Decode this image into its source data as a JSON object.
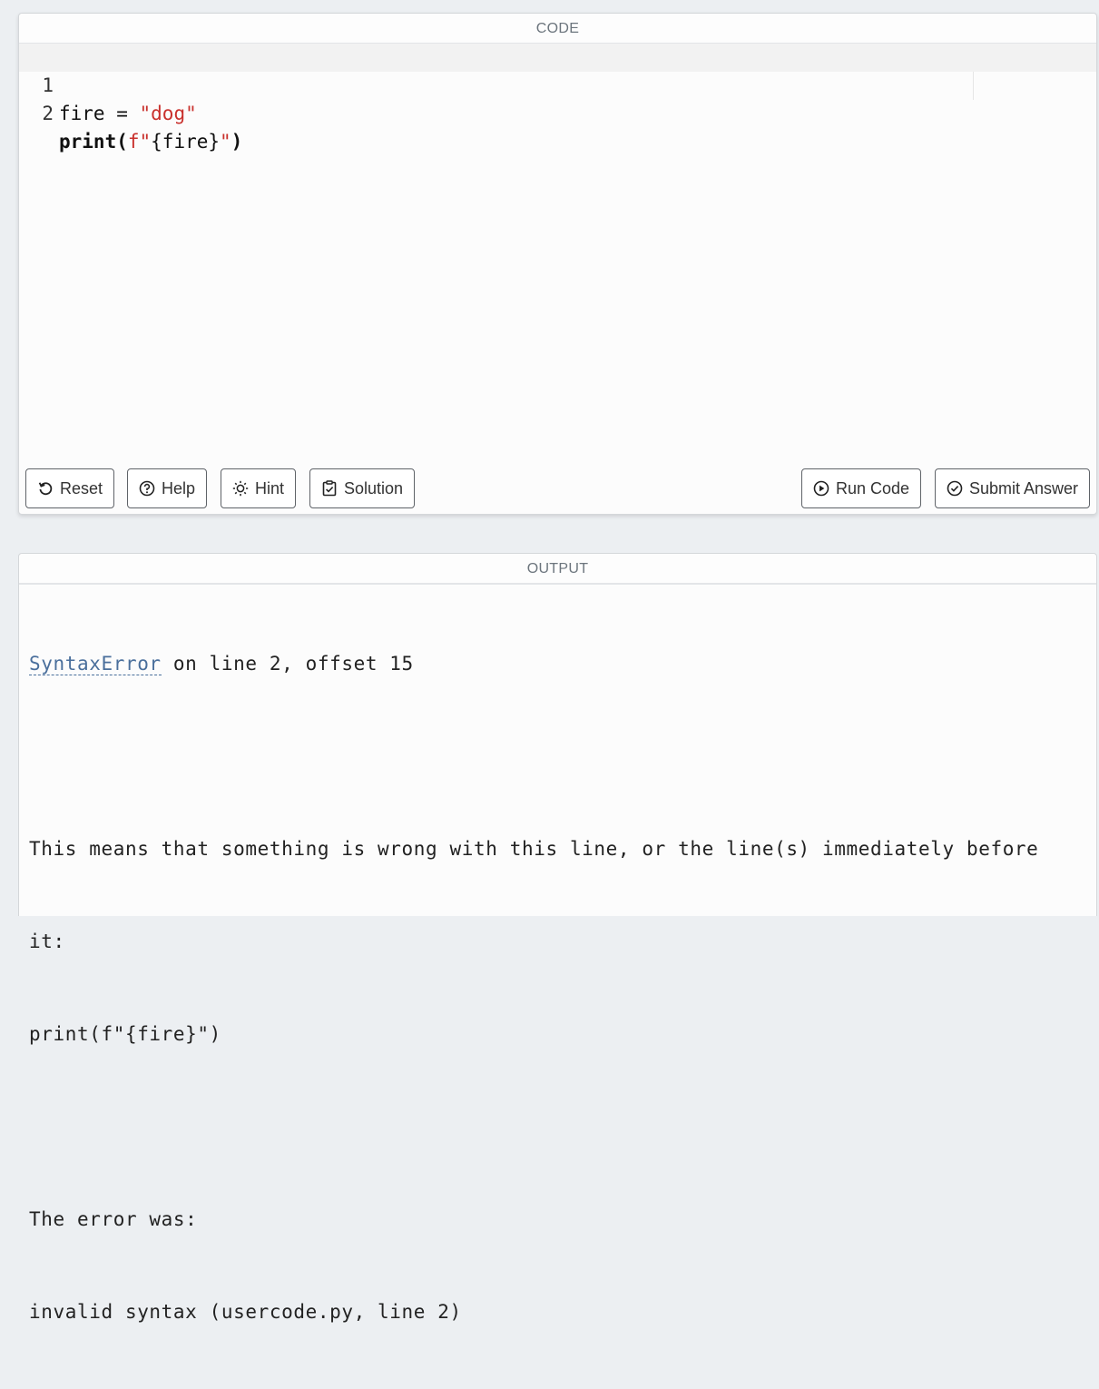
{
  "code_panel": {
    "header": "CODE",
    "lines": [
      {
        "number": "1",
        "tokens": {
          "var": "fire",
          "op": " = ",
          "str": "\"dog\""
        }
      },
      {
        "number": "2",
        "tokens": {
          "kw": "print(",
          "fstr_prefix": "f\"",
          "fstr_body": "{fire}",
          "fstr_end": "\"",
          "close": ")"
        }
      }
    ],
    "buttons": {
      "reset": "Reset",
      "help": "Help",
      "hint": "Hint",
      "solution": "Solution",
      "run": "Run Code",
      "submit": "Submit Answer"
    }
  },
  "output_panel": {
    "header": "OUTPUT",
    "error_name": "SyntaxError",
    "error_location": " on line 2, offset 15",
    "explanation_line1": "This means that something is wrong with this line, or the line(s) immediately before",
    "explanation_line2": "it:",
    "offending_code": "print(f\"{fire}\")",
    "error_was_label": "The error was:",
    "error_message": "invalid syntax (usercode.py, line 2)"
  },
  "colors": {
    "background": "#eceff2",
    "string": "#c9302c",
    "error_link": "#4a6f9c"
  }
}
